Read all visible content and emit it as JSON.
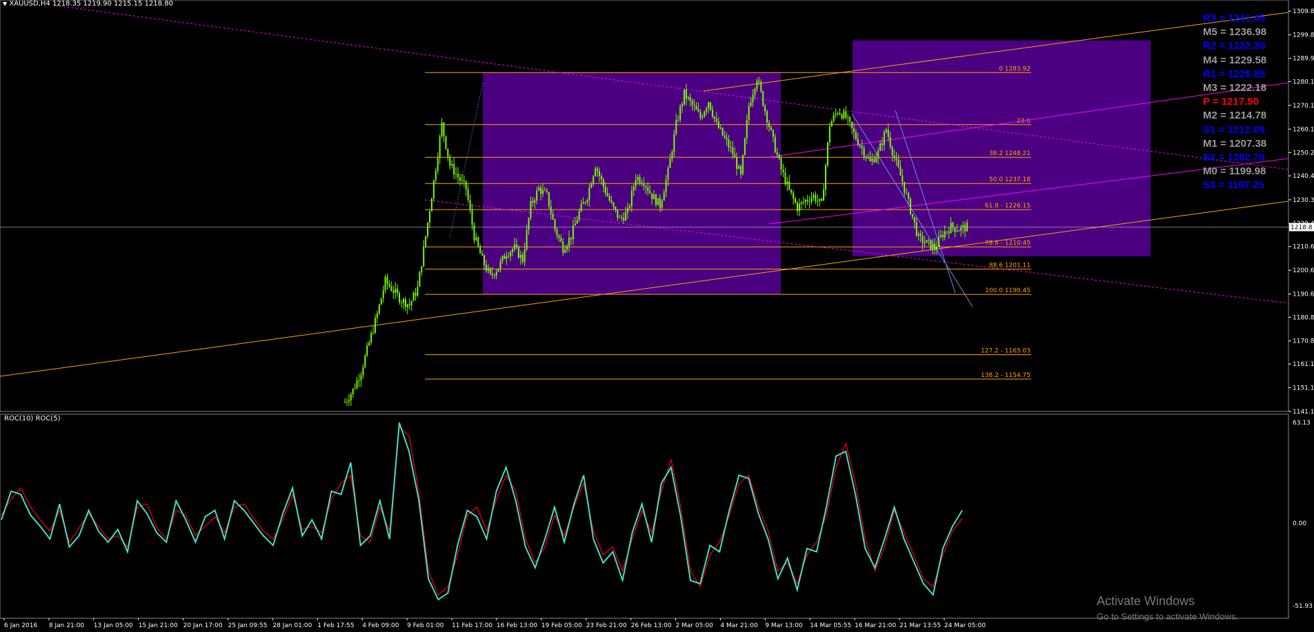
{
  "header": {
    "symbol": "XAUUSD,H4",
    "ohlc": "1218.35 1219.90 1215.15 1218.80",
    "indicator_label": "ROC(10) ROC(5)"
  },
  "pivots": [
    {
      "label": "R3 = 1241.45",
      "color": "#0000ff"
    },
    {
      "label": "M5 = 1236.98",
      "color": "#9a9a9a"
    },
    {
      "label": "R2 = 1232.30",
      "color": "#0000ff"
    },
    {
      "label": "M4 = 1229.58",
      "color": "#9a9a9a"
    },
    {
      "label": "R1 = 1226.85",
      "color": "#0000ff"
    },
    {
      "label": "M3 = 1222.18",
      "color": "#9a9a9a"
    },
    {
      "label": "P = 1217.50",
      "color": "#ff0000"
    },
    {
      "label": "M2 = 1214.78",
      "color": "#9a9a9a"
    },
    {
      "label": "S1 = 1212.05",
      "color": "#0000ff"
    },
    {
      "label": "M1 = 1207.38",
      "color": "#9a9a9a"
    },
    {
      "label": "S2 = 1202.70",
      "color": "#0000ff"
    },
    {
      "label": "M0 = 1199.98",
      "color": "#9a9a9a"
    },
    {
      "label": "S3 = 1197.25",
      "color": "#0000ff"
    }
  ],
  "watermark": {
    "line1": "Activate Windows",
    "line2": "Go to Settings to activate Windows."
  },
  "colors": {
    "background": "#000000",
    "candle": "#7cfc00",
    "rectangle": "#4b0082",
    "fib": "#ffa500",
    "trend_magenta": "#ff00ff",
    "roc_fast": "#ff0000",
    "roc_slow": "#40e0d0",
    "current_price_line": "#c0c0c0"
  },
  "chart_data": [
    {
      "type": "candlestick",
      "instrument": "XAUUSD",
      "timeframe": "H4",
      "price_ticks": [
        "1309.8",
        "1299.8",
        "1289.9",
        "1280.1",
        "1270.1",
        "1260.1",
        "1250.2",
        "1240.4",
        "1230.3",
        "1220.4",
        "1210.6",
        "1200.6",
        "1190.6",
        "1180.8",
        "1170.8",
        "1161.1",
        "1151.1",
        "1141.1"
      ],
      "current_price": "1218.80",
      "current_price_label": "1218.8",
      "time_ticks": [
        "6 Jan 2016",
        "8 Jan 21:00",
        "13 Jan 05:00",
        "15 Jan 21:00",
        "20 Jan 17:00",
        "25 Jan 09:55",
        "28 Jan 01:00",
        "1 Feb 17:55",
        "4 Feb 09:00",
        "9 Feb 01:00",
        "11 Feb 17:00",
        "16 Feb 13:00",
        "19 Feb 05:00",
        "23 Feb 21:00",
        "26 Feb 13:00",
        "2 Mar 05:00",
        "4 Mar 21:00",
        "9 Mar 13:00",
        "14 Mar 05:55",
        "16 Mar 21:00",
        "21 Mar 13:55",
        "24 Mar 05:00"
      ],
      "fibonacci_levels": [
        {
          "label": "0 1283.92",
          "value": 1283.92
        },
        {
          "label": "23.6",
          "value": 1262.0
        },
        {
          "label": "38.2 1248.21",
          "value": 1248.21
        },
        {
          "label": "50.0 1237.18",
          "value": 1237.18
        },
        {
          "label": "61.8 - 1226.15",
          "value": 1226.15
        },
        {
          "label": "78.6 - 1210.45",
          "value": 1210.45
        },
        {
          "label": "88.6 1201.11",
          "value": 1201.11
        },
        {
          "label": "100.0 1190.45",
          "value": 1190.45
        },
        {
          "label": "127.2 - 1165.03",
          "value": 1165.03
        },
        {
          "label": "138.2 - 1154.75",
          "value": 1154.75
        }
      ],
      "close_path": [
        1145,
        1150,
        1158,
        1170,
        1182,
        1196,
        1192,
        1188,
        1186,
        1193,
        1215,
        1238,
        1262,
        1245,
        1240,
        1235,
        1215,
        1205,
        1198,
        1202,
        1208,
        1210,
        1205,
        1228,
        1235,
        1232,
        1218,
        1210,
        1215,
        1225,
        1232,
        1245,
        1236,
        1228,
        1222,
        1225,
        1240,
        1238,
        1232,
        1228,
        1242,
        1262,
        1275,
        1270,
        1265,
        1272,
        1262,
        1256,
        1250,
        1240,
        1270,
        1282,
        1268,
        1255,
        1243,
        1234,
        1227,
        1230,
        1232,
        1228,
        1262,
        1268,
        1265,
        1258,
        1252,
        1246,
        1250,
        1260,
        1248,
        1238,
        1226,
        1214,
        1212,
        1210,
        1216,
        1219,
        1218,
        1218.8
      ]
    },
    {
      "type": "line",
      "name": "ROC(10) ROC(5)",
      "y_ticks": [
        "63.13",
        "0.00",
        "-51.93"
      ],
      "ylim": [
        -51.93,
        63.13
      ],
      "series": [
        {
          "name": "ROC(10)",
          "color": "#ff0000",
          "values": [
            5,
            15,
            22,
            10,
            2,
            -5,
            8,
            -12,
            -3,
            6,
            -2,
            -10,
            -8,
            -15,
            10,
            12,
            -3,
            -10,
            8,
            5,
            -8,
            -2,
            4,
            -6,
            10,
            12,
            3,
            -5,
            -10,
            2,
            18,
            -4,
            -2,
            -6,
            15,
            25,
            30,
            -8,
            -12,
            10,
            -5,
            60,
            55,
            20,
            -30,
            -45,
            -40,
            -20,
            5,
            10,
            -5,
            15,
            30,
            20,
            -10,
            -25,
            -15,
            5,
            -8,
            10,
            25,
            -5,
            -20,
            -15,
            -30,
            -10,
            8,
            -6,
            20,
            40,
            10,
            -30,
            -40,
            -20,
            -12,
            5,
            25,
            30,
            10,
            -5,
            -30,
            -25,
            -38,
            -20,
            -12,
            5,
            35,
            50,
            25,
            -10,
            -30,
            -15,
            8,
            -6,
            -20,
            -35,
            -40,
            -20,
            -5,
            3
          ]
        },
        {
          "name": "ROC(5)",
          "color": "#40e0d0",
          "values": [
            2,
            20,
            18,
            5,
            -2,
            -10,
            12,
            -15,
            -8,
            8,
            -5,
            -12,
            -4,
            -18,
            14,
            6,
            -6,
            -12,
            14,
            2,
            -12,
            4,
            8,
            -10,
            14,
            8,
            0,
            -8,
            -14,
            6,
            22,
            -8,
            2,
            -10,
            20,
            18,
            38,
            -14,
            -8,
            14,
            -10,
            63,
            45,
            15,
            -35,
            -48,
            -44,
            -14,
            8,
            4,
            -10,
            20,
            35,
            14,
            -15,
            -28,
            -10,
            10,
            -12,
            12,
            30,
            -10,
            -25,
            -18,
            -36,
            -6,
            12,
            -12,
            25,
            35,
            4,
            -36,
            -38,
            -14,
            -18,
            8,
            30,
            28,
            6,
            -10,
            -35,
            -22,
            -42,
            -16,
            -18,
            10,
            42,
            45,
            18,
            -16,
            -28,
            -10,
            10,
            -10,
            -24,
            -38,
            -45,
            -16,
            -2,
            8
          ]
        }
      ]
    }
  ]
}
